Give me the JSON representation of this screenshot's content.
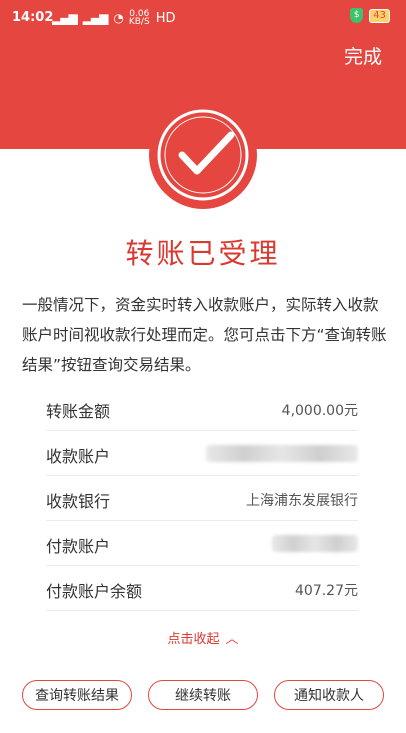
{
  "status_bar": {
    "time": "14:02",
    "signal_1": "4G",
    "signal_2": "4G",
    "net_speed": "0.06",
    "net_unit": "KB/S",
    "hd": "HD",
    "battery": "43"
  },
  "header": {
    "done_label": "完成"
  },
  "result": {
    "title": "转账已受理",
    "description": "一般情况下，资金实时转入收款账户，实际转入收款账户时间视收款行处理而定。您可点击下方“查询转账结果”按钮查询交易结果。"
  },
  "details": [
    {
      "label": "转账金额",
      "value": "4,000.00元"
    },
    {
      "label": "收款账户",
      "value": ""
    },
    {
      "label": "收款银行",
      "value": "上海浦东发展银行"
    },
    {
      "label": "付款账户",
      "value": ""
    },
    {
      "label": "付款账户余额",
      "value": "407.27元"
    }
  ],
  "collapse_label": "点击收起",
  "actions": {
    "query": "查询转账结果",
    "continue": "继续转账",
    "notify": "通知收款人"
  },
  "colors": {
    "accent": "#e5463f"
  }
}
